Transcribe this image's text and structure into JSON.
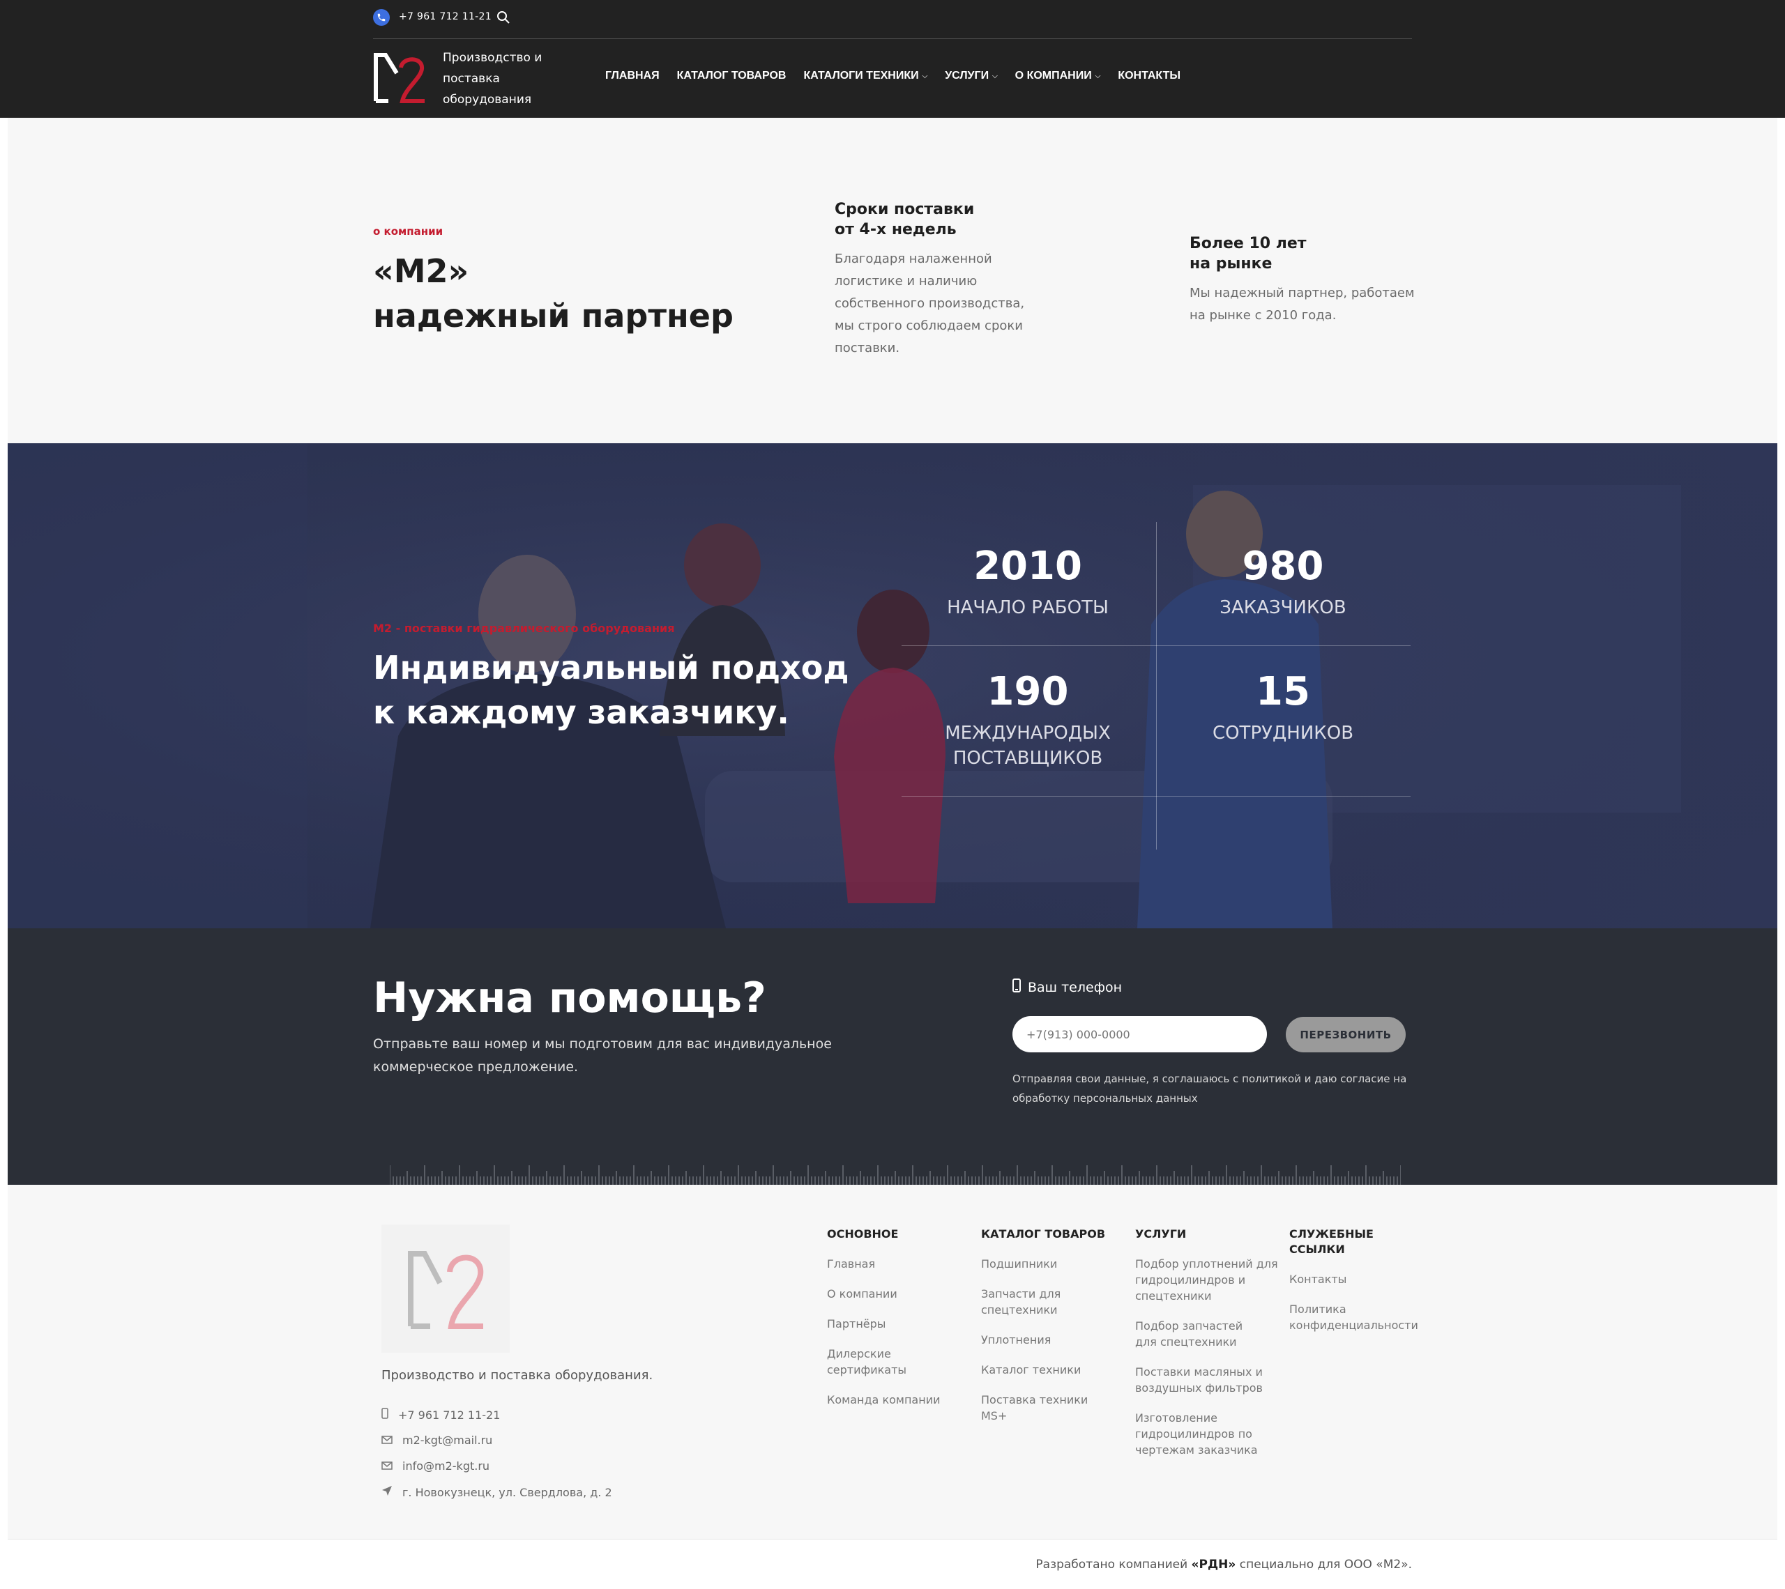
{
  "header": {
    "phone": "+7 961 712 11-21",
    "logo_text": "Производство и поставка оборудования",
    "nav": [
      {
        "label": "Главная"
      },
      {
        "label": "Каталог товаров"
      },
      {
        "label": "Каталоги техники"
      },
      {
        "label": "Услуги"
      },
      {
        "label": "О компании"
      },
      {
        "label": "Контакты"
      }
    ]
  },
  "about": {
    "eyebrow": "о компании",
    "title_line1": "«М2»",
    "title_line2": "надежный партнер",
    "features": [
      {
        "title_line1": "Сроки поставки",
        "title_line2": "от 4-х недель",
        "text": "Благодаря налаженной логистике и наличию собственного производства, мы строго соблюдаем сроки поставки."
      },
      {
        "title_line1": "Более 10 лет",
        "title_line2": "на рынке",
        "text": "Мы надежный партнер, работаем на рынке с 2010 года."
      }
    ]
  },
  "stats": {
    "eyebrow": "М2 - поставки гидравлического оборудования",
    "title": "Индивидуальный подход к каждому заказчику.",
    "items": [
      {
        "value": "2010",
        "label": "Начало работы"
      },
      {
        "value": "980",
        "label": "Заказчиков"
      },
      {
        "value": "190",
        "label": "Международых поставщиков"
      },
      {
        "value": "15",
        "label": "Сотрудников"
      }
    ]
  },
  "help": {
    "title": "Нужна помощь?",
    "text": "Отправьте ваш номер и мы подготовим для вас индивидуальное коммерческое предложение.",
    "phone_label": "Ваш телефон",
    "phone_placeholder": "+7(913) 000-0000",
    "button": "Перезвонить",
    "consent": "Отправляя свои данные, я соглашаюсь с политикой и даю согласие на обработку персональных данных"
  },
  "footer": {
    "tagline": "Производство и поставка оборудования.",
    "contacts": {
      "phone": "+7 961 712 11-21",
      "email1": "m2-kgt@mail.ru",
      "email2": "info@m2-kgt.ru",
      "address": "г. Новокузнецк, ул. Свердлова, д. 2"
    },
    "columns": [
      {
        "title": "Основное",
        "links": [
          "Главная",
          "О компании",
          "Партнёры",
          "Дилерские сертификаты",
          "Команда компании"
        ]
      },
      {
        "title": "Каталог товаров",
        "links": [
          "Подшипники",
          "Запчасти для спецтехники",
          "Уплотнения",
          "Каталог техники",
          "Поставка техники MS+"
        ]
      },
      {
        "title": "Услуги",
        "links": [
          "Подбор уплотнений для гидроцилиндров и спецтехники",
          "Подбор запчастей для спецтехники",
          "Поставки масляных и воздушных фильтров",
          "Изготовление гидроцилиндров по чертежам заказчика"
        ]
      },
      {
        "title": "Служебные ссылки",
        "links": [
          "Контакты",
          "Политика конфиденциальности"
        ]
      }
    ],
    "credits_prefix": "Разработано компанией",
    "credits_company": "«РДН»",
    "credits_suffix": "специально для ООО «М2»."
  },
  "colors": {
    "header_bg": "#222222",
    "accent_red": "#c41c2f",
    "stats_bg": "#2b3250",
    "help_bg": "#2b2f37",
    "footer_bg": "#f7f7f7"
  }
}
